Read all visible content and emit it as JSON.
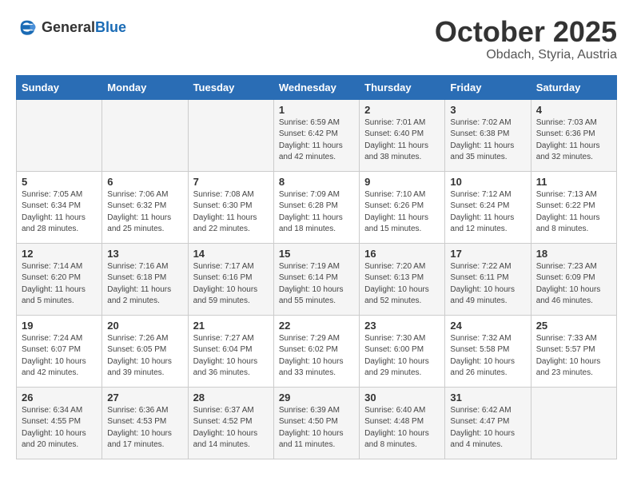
{
  "header": {
    "logo_general": "General",
    "logo_blue": "Blue",
    "month": "October 2025",
    "location": "Obdach, Styria, Austria"
  },
  "weekdays": [
    "Sunday",
    "Monday",
    "Tuesday",
    "Wednesday",
    "Thursday",
    "Friday",
    "Saturday"
  ],
  "weeks": [
    [
      {
        "day": "",
        "info": ""
      },
      {
        "day": "",
        "info": ""
      },
      {
        "day": "",
        "info": ""
      },
      {
        "day": "1",
        "info": "Sunrise: 6:59 AM\nSunset: 6:42 PM\nDaylight: 11 hours\nand 42 minutes."
      },
      {
        "day": "2",
        "info": "Sunrise: 7:01 AM\nSunset: 6:40 PM\nDaylight: 11 hours\nand 38 minutes."
      },
      {
        "day": "3",
        "info": "Sunrise: 7:02 AM\nSunset: 6:38 PM\nDaylight: 11 hours\nand 35 minutes."
      },
      {
        "day": "4",
        "info": "Sunrise: 7:03 AM\nSunset: 6:36 PM\nDaylight: 11 hours\nand 32 minutes."
      }
    ],
    [
      {
        "day": "5",
        "info": "Sunrise: 7:05 AM\nSunset: 6:34 PM\nDaylight: 11 hours\nand 28 minutes."
      },
      {
        "day": "6",
        "info": "Sunrise: 7:06 AM\nSunset: 6:32 PM\nDaylight: 11 hours\nand 25 minutes."
      },
      {
        "day": "7",
        "info": "Sunrise: 7:08 AM\nSunset: 6:30 PM\nDaylight: 11 hours\nand 22 minutes."
      },
      {
        "day": "8",
        "info": "Sunrise: 7:09 AM\nSunset: 6:28 PM\nDaylight: 11 hours\nand 18 minutes."
      },
      {
        "day": "9",
        "info": "Sunrise: 7:10 AM\nSunset: 6:26 PM\nDaylight: 11 hours\nand 15 minutes."
      },
      {
        "day": "10",
        "info": "Sunrise: 7:12 AM\nSunset: 6:24 PM\nDaylight: 11 hours\nand 12 minutes."
      },
      {
        "day": "11",
        "info": "Sunrise: 7:13 AM\nSunset: 6:22 PM\nDaylight: 11 hours\nand 8 minutes."
      }
    ],
    [
      {
        "day": "12",
        "info": "Sunrise: 7:14 AM\nSunset: 6:20 PM\nDaylight: 11 hours\nand 5 minutes."
      },
      {
        "day": "13",
        "info": "Sunrise: 7:16 AM\nSunset: 6:18 PM\nDaylight: 11 hours\nand 2 minutes."
      },
      {
        "day": "14",
        "info": "Sunrise: 7:17 AM\nSunset: 6:16 PM\nDaylight: 10 hours\nand 59 minutes."
      },
      {
        "day": "15",
        "info": "Sunrise: 7:19 AM\nSunset: 6:14 PM\nDaylight: 10 hours\nand 55 minutes."
      },
      {
        "day": "16",
        "info": "Sunrise: 7:20 AM\nSunset: 6:13 PM\nDaylight: 10 hours\nand 52 minutes."
      },
      {
        "day": "17",
        "info": "Sunrise: 7:22 AM\nSunset: 6:11 PM\nDaylight: 10 hours\nand 49 minutes."
      },
      {
        "day": "18",
        "info": "Sunrise: 7:23 AM\nSunset: 6:09 PM\nDaylight: 10 hours\nand 46 minutes."
      }
    ],
    [
      {
        "day": "19",
        "info": "Sunrise: 7:24 AM\nSunset: 6:07 PM\nDaylight: 10 hours\nand 42 minutes."
      },
      {
        "day": "20",
        "info": "Sunrise: 7:26 AM\nSunset: 6:05 PM\nDaylight: 10 hours\nand 39 minutes."
      },
      {
        "day": "21",
        "info": "Sunrise: 7:27 AM\nSunset: 6:04 PM\nDaylight: 10 hours\nand 36 minutes."
      },
      {
        "day": "22",
        "info": "Sunrise: 7:29 AM\nSunset: 6:02 PM\nDaylight: 10 hours\nand 33 minutes."
      },
      {
        "day": "23",
        "info": "Sunrise: 7:30 AM\nSunset: 6:00 PM\nDaylight: 10 hours\nand 29 minutes."
      },
      {
        "day": "24",
        "info": "Sunrise: 7:32 AM\nSunset: 5:58 PM\nDaylight: 10 hours\nand 26 minutes."
      },
      {
        "day": "25",
        "info": "Sunrise: 7:33 AM\nSunset: 5:57 PM\nDaylight: 10 hours\nand 23 minutes."
      }
    ],
    [
      {
        "day": "26",
        "info": "Sunrise: 6:34 AM\nSunset: 4:55 PM\nDaylight: 10 hours\nand 20 minutes."
      },
      {
        "day": "27",
        "info": "Sunrise: 6:36 AM\nSunset: 4:53 PM\nDaylight: 10 hours\nand 17 minutes."
      },
      {
        "day": "28",
        "info": "Sunrise: 6:37 AM\nSunset: 4:52 PM\nDaylight: 10 hours\nand 14 minutes."
      },
      {
        "day": "29",
        "info": "Sunrise: 6:39 AM\nSunset: 4:50 PM\nDaylight: 10 hours\nand 11 minutes."
      },
      {
        "day": "30",
        "info": "Sunrise: 6:40 AM\nSunset: 4:48 PM\nDaylight: 10 hours\nand 8 minutes."
      },
      {
        "day": "31",
        "info": "Sunrise: 6:42 AM\nSunset: 4:47 PM\nDaylight: 10 hours\nand 4 minutes."
      },
      {
        "day": "",
        "info": ""
      }
    ]
  ]
}
